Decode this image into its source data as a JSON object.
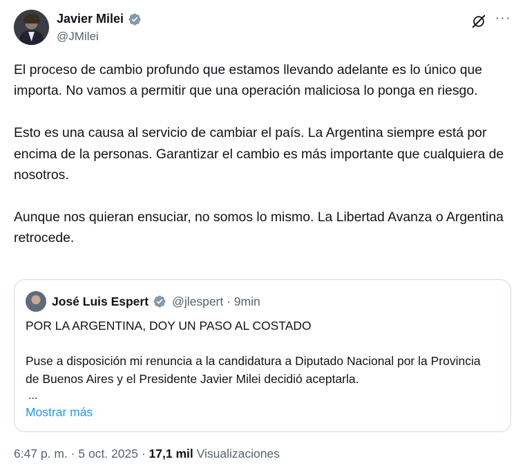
{
  "author": {
    "display_name": "Javier Milei",
    "handle": "@JMilei",
    "verified_icon": "verified-badge-icon"
  },
  "toolbar": {
    "grok_icon": "grok-slash-icon",
    "more_icon": "more-dots-icon",
    "more_label": "···"
  },
  "tweet": {
    "paragraphs": [
      "El proceso de cambio profundo que estamos llevando adelante es lo único que importa. No vamos a permitir que una operación maliciosa lo ponga en riesgo.",
      "Esto es una causa al servicio de cambiar el país. La Argentina siempre está por encima de la personas. Garantizar el cambio es más importante que cualquiera de nosotros.",
      "Aunque nos quieran ensuciar, no somos lo mismo. La Libertad Avanza o Argentina retrocede."
    ]
  },
  "quote": {
    "display_name": "José Luis Espert",
    "meta": "@jlespert · 9min",
    "title": "POR LA ARGENTINA, DOY UN PASO AL COSTADO",
    "text": "Puse a disposición mi renuncia a la candidatura a Diputado Nacional por la Provincia de Buenos Aires y el Presidente Javier Milei decidió aceptarla.",
    "ellipsis": "...",
    "show_more": "Mostrar más"
  },
  "footer": {
    "timestamp": "6:47 p. m. · 5 oct. 2025 · ",
    "views_count": "17,1 mil",
    "views_label": " Visualizaciones"
  },
  "colors": {
    "text": "#0f1419",
    "secondary": "#536471",
    "link": "#1d9bf0",
    "verified": "#829aab",
    "border": "#cfd9de"
  }
}
